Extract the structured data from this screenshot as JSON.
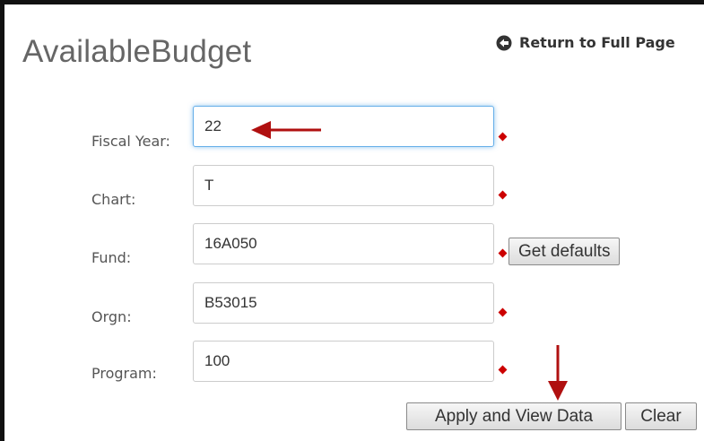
{
  "page": {
    "title": "AvailableBudget",
    "return_link_label": "Return to Full Page"
  },
  "form": {
    "fields": [
      {
        "label": "Fiscal Year:",
        "value": "22"
      },
      {
        "label": "Chart:",
        "value": "T"
      },
      {
        "label": "Fund:",
        "value": "16A050"
      },
      {
        "label": "Orgn:",
        "value": "B53015"
      },
      {
        "label": "Program:",
        "value": "100"
      }
    ],
    "get_defaults_label": "Get defaults",
    "apply_label": "Apply and View Data",
    "clear_label": "Clear"
  },
  "colors": {
    "annotation_arrow": "#b01010",
    "required_marker": "#cc0000",
    "focus_border": "#66afe9"
  },
  "icons": {
    "return": "circle-left-arrow-icon"
  }
}
